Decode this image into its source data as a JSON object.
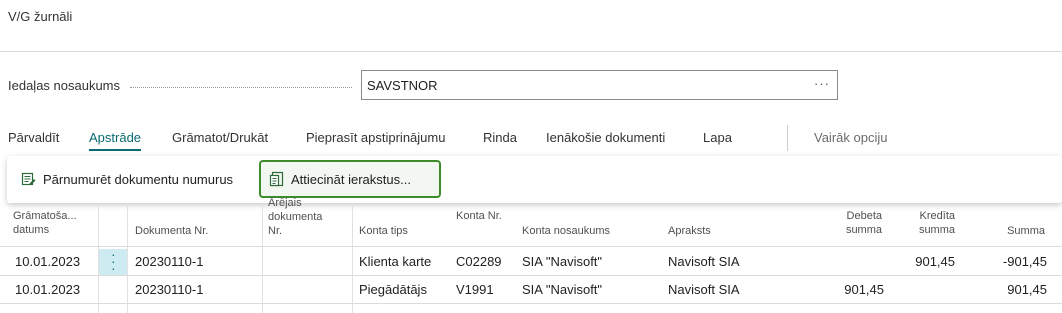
{
  "page": {
    "title": "V/G žurnāli"
  },
  "batch_field": {
    "label": "Iedaļas nosaukums",
    "value": "SAVSTNOR",
    "more_icon": "ellipsis-icon"
  },
  "actionbar": {
    "items": [
      "Pārvaldīt",
      "Apstrāde",
      "Grāmatot/Drukāt",
      "Pieprasīt apstiprinājumu",
      "Rinda",
      "Ienākošie dokumenti",
      "Lapa",
      "Vairāk opciju"
    ],
    "active_index": 1
  },
  "dropdown": {
    "renumber": {
      "label": "Pārnumurēt dokumentu numurus",
      "icon": "renumber-icon"
    },
    "apply": {
      "label": "Attiecināt ierakstus...",
      "icon": "apply-entries-icon"
    }
  },
  "grid": {
    "headers": {
      "posting_date": "Grāmatoša... datums",
      "doc_no": "Dokumenta Nr.",
      "ext_doc_no": "Ārējais dokumenta Nr.",
      "account_type": "Konta tips",
      "account_no": "Konta Nr.",
      "account_name": "Konta nosaukums",
      "description": "Apraksts",
      "debit": "Debeta summa",
      "credit": "Kredīta summa",
      "amount": "Summa"
    },
    "rows": [
      {
        "posting_date": "10.01.2023",
        "doc_no": "20230110-1",
        "ext_doc_no": "",
        "account_type": "Klienta karte",
        "account_no": "C02289",
        "account_name": "SIA \"Navisoft\"",
        "description": "Navisoft SIA",
        "debit": "",
        "credit": "901,45",
        "amount": "-901,45"
      },
      {
        "posting_date": "10.01.2023",
        "doc_no": "20230110-1",
        "ext_doc_no": "",
        "account_type": "Piegādātājs",
        "account_no": "V1991",
        "account_name": "SIA \"Navisoft\"",
        "description": "Navisoft SIA",
        "debit": "901,45",
        "credit": "",
        "amount": "901,45"
      }
    ]
  },
  "colors": {
    "accent": "#0a6b72",
    "highlight_border": "#3c8c2c",
    "row_select": "#cdebf0"
  }
}
